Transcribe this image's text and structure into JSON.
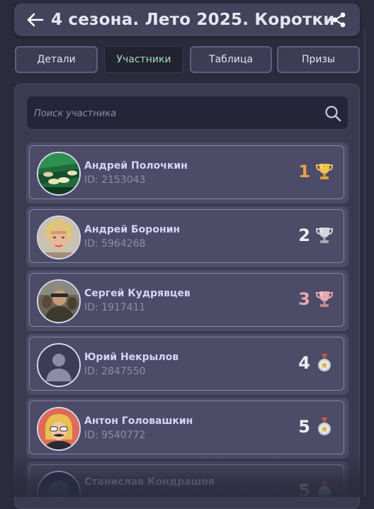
{
  "header": {
    "title": "4 сезона. Лето 2025. Коротки...",
    "back_icon": "arrow-left-icon",
    "share_icon": "share-icon"
  },
  "tabs": [
    {
      "label": "Детали",
      "active": false
    },
    {
      "label": "Участники",
      "active": true
    },
    {
      "label": "Таблица",
      "active": false
    },
    {
      "label": "Призы",
      "active": false
    }
  ],
  "search": {
    "placeholder": "Поиск участника",
    "value": ""
  },
  "participants": [
    {
      "name": "Андрей Полочкин",
      "id": "ID: 2153043",
      "rank": "1",
      "award": "gold-trophy-icon",
      "rank_color": "#e6a24a"
    },
    {
      "name": "Андрей Боронин",
      "id": "ID: 5964268",
      "rank": "2",
      "award": "silver-trophy-icon",
      "rank_color": "#ececf6"
    },
    {
      "name": "Сергей Кудрявцев",
      "id": "ID: 1917411",
      "rank": "3",
      "award": "bronze-trophy-icon",
      "rank_color": "#e8a8b0"
    },
    {
      "name": "Юрий Некрылов",
      "id": "ID: 2847550",
      "rank": "4",
      "award": "medal-icon",
      "rank_color": "#ececf6"
    },
    {
      "name": "Антон Головашкин",
      "id": "ID: 9540772",
      "rank": "5",
      "award": "medal-icon",
      "rank_color": "#ececf6"
    },
    {
      "name": "Станислав Кондрашов",
      "id": "",
      "rank": "5",
      "award": "medal-icon",
      "rank_color": "#ececf6"
    }
  ],
  "colors": {
    "background": "#2b2b3e",
    "card": "#4c4c68",
    "active_tab_text": "#9fe0b4",
    "name_text": "#d4d4f4"
  }
}
